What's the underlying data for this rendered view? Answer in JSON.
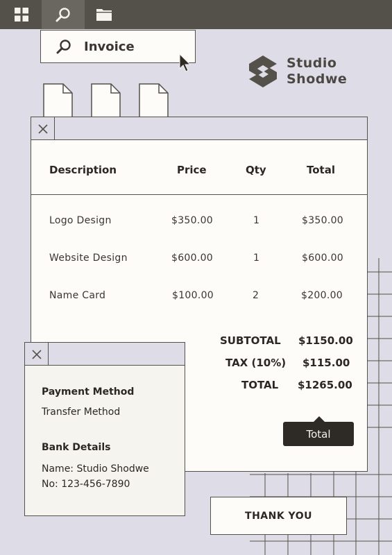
{
  "toolbar": {
    "items": [
      {
        "icon": "grid-icon"
      },
      {
        "icon": "search-icon",
        "active": true
      },
      {
        "icon": "folder-icon"
      }
    ]
  },
  "search": {
    "value": "Invoice"
  },
  "brand": {
    "line1": "Studio",
    "line2": "Shodwe"
  },
  "invoice": {
    "columns": [
      "Description",
      "Price",
      "Qty",
      "Total"
    ],
    "rows": [
      {
        "description": "Logo Design",
        "price": "$350.00",
        "qty": "1",
        "total": "$350.00"
      },
      {
        "description": "Website Design",
        "price": "$600.00",
        "qty": "1",
        "total": "$600.00"
      },
      {
        "description": "Name Card",
        "price": "$100.00",
        "qty": "2",
        "total": "$200.00"
      }
    ],
    "summary": [
      {
        "label": "SUBTOTAL",
        "value": "$1150.00"
      },
      {
        "label": "TAX (10%)",
        "value": "$115.00"
      },
      {
        "label": "TOTAL",
        "value": "$1265.00"
      }
    ]
  },
  "tooltip": {
    "text": "Total"
  },
  "payment": {
    "method_heading": "Payment Method",
    "method_value": "Transfer Method",
    "bank_heading": "Bank Details",
    "bank_name": "Name: Studio Shodwe",
    "bank_no": "No: 123-456-7890"
  },
  "footer": {
    "thanks": "THANK YOU"
  },
  "colors": {
    "background": "#dedce6",
    "bar": "#54504a",
    "paper": "#fdfcf8",
    "dark": "#2e2b27"
  }
}
